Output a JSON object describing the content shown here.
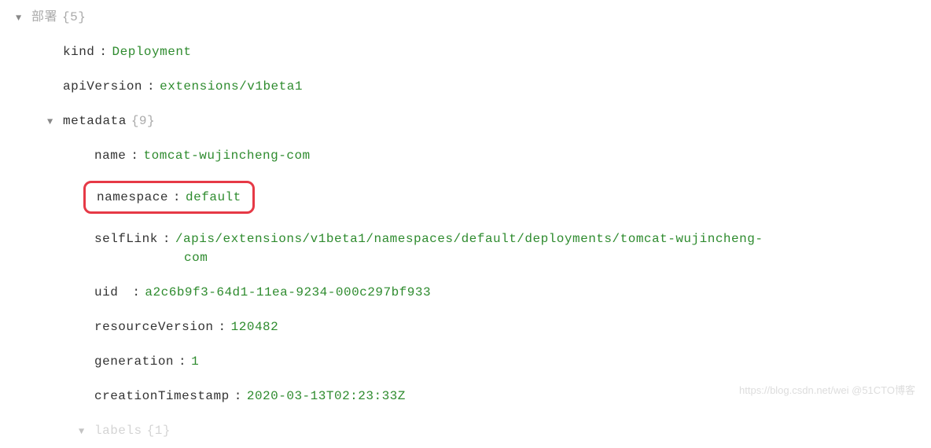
{
  "root": {
    "label": "部署",
    "count": "{5}"
  },
  "kind": {
    "key": "kind",
    "value": "Deployment"
  },
  "apiVersion": {
    "key": "apiVersion",
    "value": "extensions/v1beta1"
  },
  "metadata": {
    "key": "metadata",
    "count": "{9}"
  },
  "name": {
    "key": "name",
    "value": "tomcat-wujincheng-com"
  },
  "namespace": {
    "key": "namespace",
    "value": "default"
  },
  "selfLink": {
    "key": "selfLink",
    "valueLine1": "/apis/extensions/v1beta1/namespaces/default/deployments/tomcat-wujincheng-",
    "valueLine2": "com"
  },
  "uid": {
    "key": "uid",
    "value": "a2c6b9f3-64d1-11ea-9234-000c297bf933"
  },
  "resourceVersion": {
    "key": "resourceVersion",
    "value": "120482"
  },
  "generation": {
    "key": "generation",
    "value": "1"
  },
  "creationTimestamp": {
    "key": "creationTimestamp",
    "value": "2020-03-13T02:23:33Z"
  },
  "labels": {
    "key": "labels",
    "count": "{1}"
  },
  "watermark": "https://blog.csdn.net/wei @51CTO博客"
}
